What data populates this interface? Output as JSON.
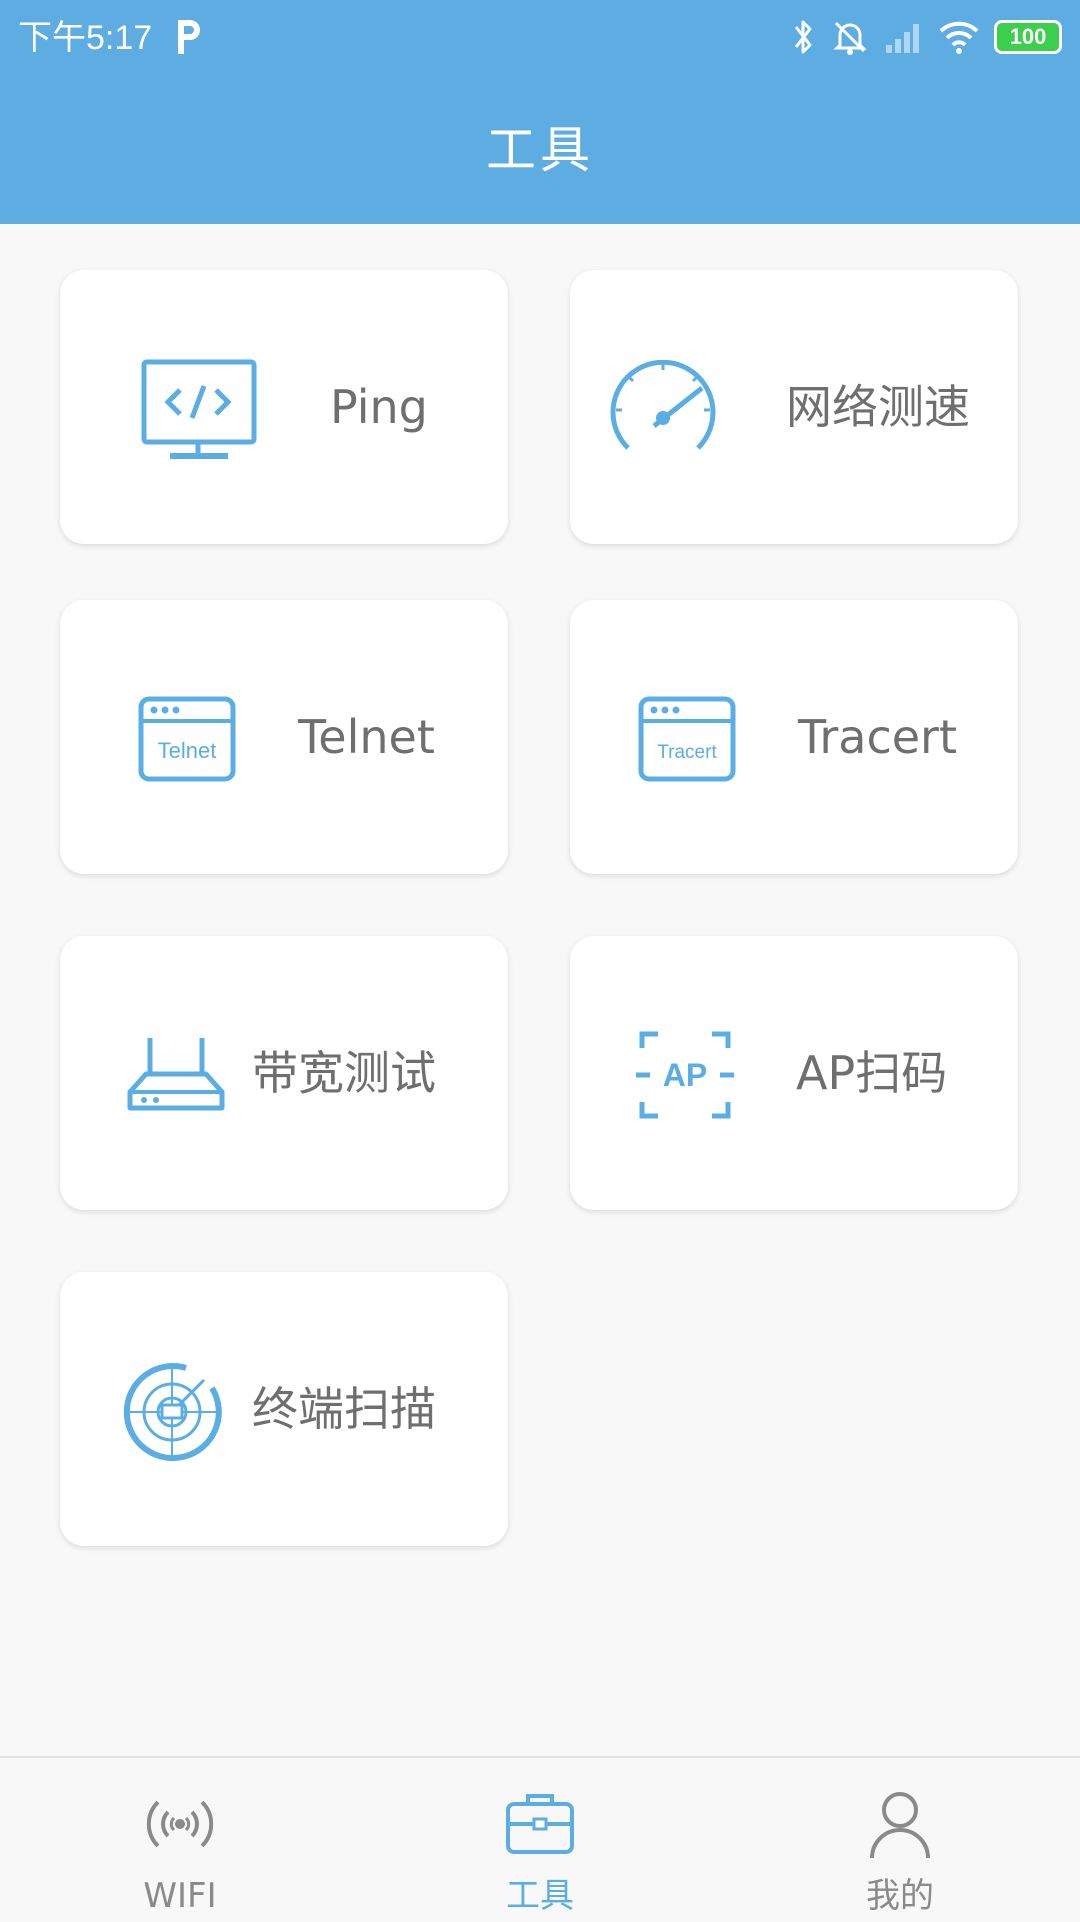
{
  "status_bar": {
    "time": "下午5:17",
    "battery": "100"
  },
  "header": {
    "title": "工具"
  },
  "tools": [
    {
      "label": "Ping",
      "icon": "code-monitor-icon"
    },
    {
      "label": "网络测速",
      "icon": "speedometer-icon"
    },
    {
      "label": "Telnet",
      "icon": "telnet-window-icon",
      "icon_text": "Telnet"
    },
    {
      "label": "Tracert",
      "icon": "tracert-window-icon",
      "icon_text": "Tracert"
    },
    {
      "label": "带宽测试",
      "icon": "router-icon"
    },
    {
      "label": "AP扫码",
      "icon": "ap-scan-icon",
      "icon_text": "AP"
    },
    {
      "label": "终端扫描",
      "icon": "radar-scan-icon"
    }
  ],
  "tabbar": {
    "items": [
      {
        "label": "WIFI",
        "icon": "wifi-broadcast-icon",
        "active": false
      },
      {
        "label": "工具",
        "icon": "toolbox-icon",
        "active": true
      },
      {
        "label": "我的",
        "icon": "user-icon",
        "active": false
      }
    ]
  },
  "colors": {
    "primary": "#5dade2",
    "icon_blue": "#5aaee3",
    "label_gray": "#6f6f6f",
    "tab_inactive": "#8a8a8a"
  }
}
